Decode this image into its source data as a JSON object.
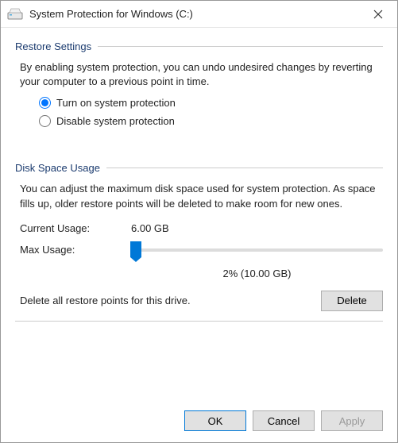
{
  "window": {
    "title": "System Protection for Windows (C:)"
  },
  "restore": {
    "heading": "Restore Settings",
    "description": "By enabling system protection, you can undo undesired changes by reverting your computer to a previous point in time.",
    "option_on": "Turn on system protection",
    "option_off": "Disable system protection"
  },
  "disk": {
    "heading": "Disk Space Usage",
    "description": "You can adjust the maximum disk space used for system protection. As space fills up, older restore points will be deleted to make room for new ones.",
    "current_label": "Current Usage:",
    "current_value": "6.00 GB",
    "max_label": "Max Usage:",
    "slider_value": "2% (10.00 GB)",
    "delete_text": "Delete all restore points for this drive.",
    "delete_button": "Delete"
  },
  "buttons": {
    "ok": "OK",
    "cancel": "Cancel",
    "apply": "Apply"
  }
}
